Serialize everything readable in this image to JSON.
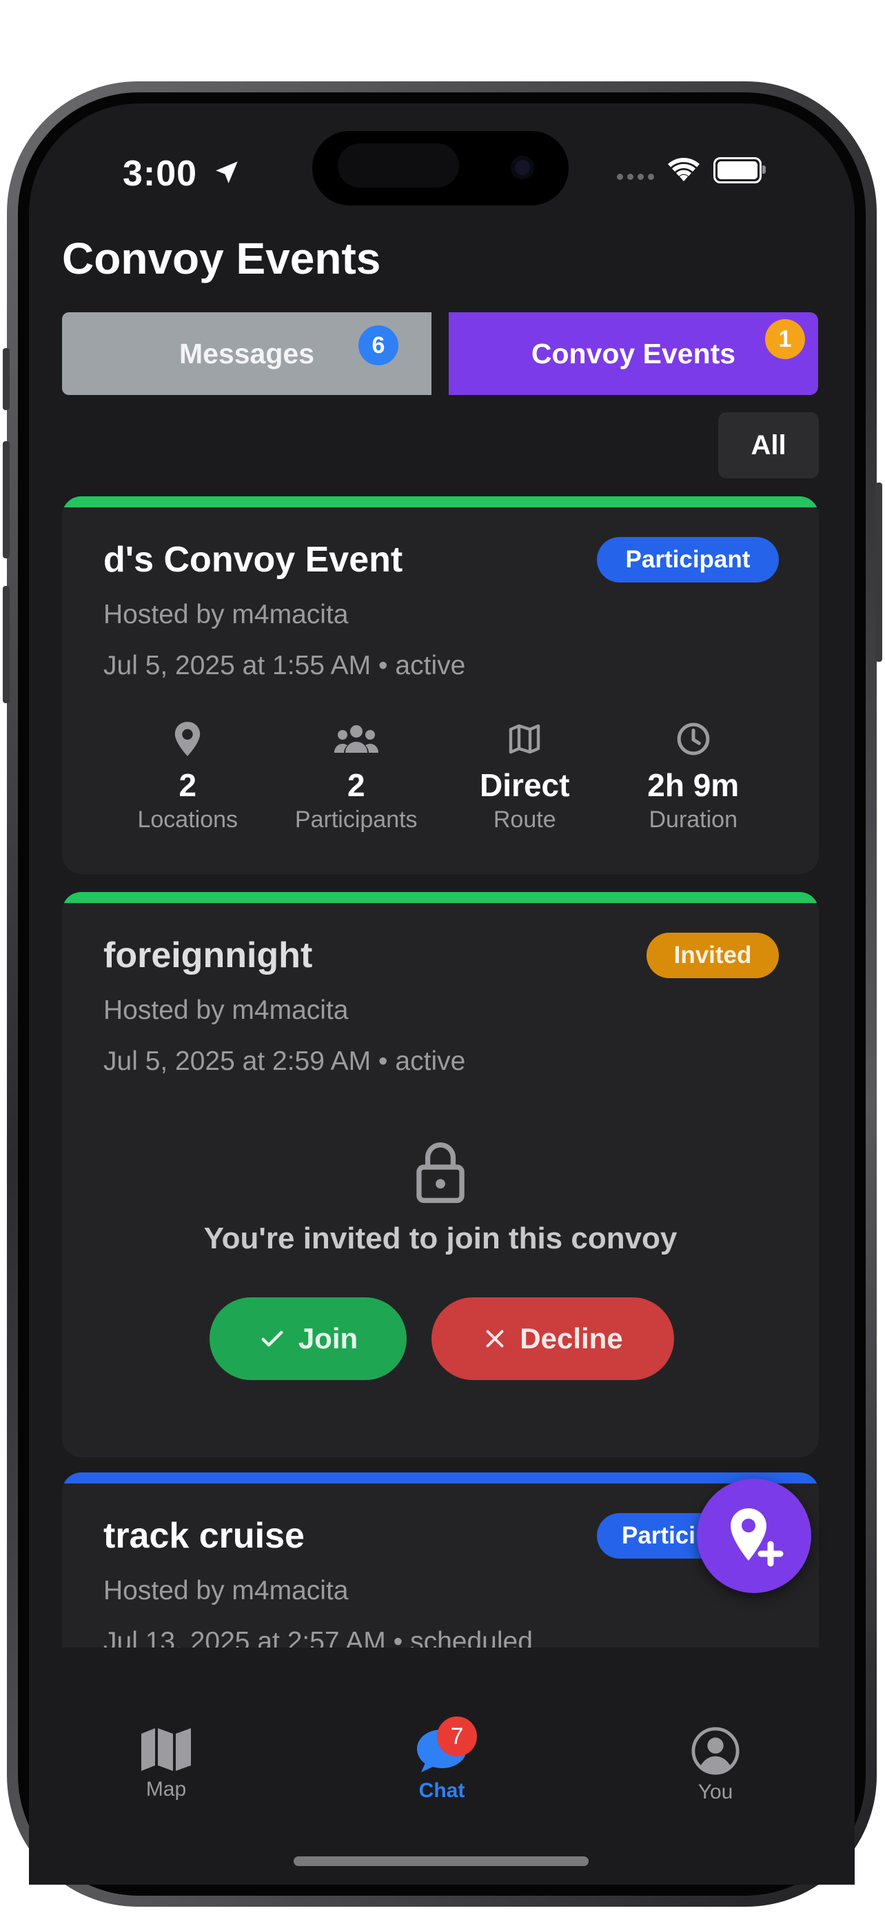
{
  "status_bar": {
    "time": "3:00"
  },
  "page": {
    "title": "Convoy Events"
  },
  "tabs": {
    "messages": {
      "label": "Messages",
      "badge": "6"
    },
    "events": {
      "label": "Convoy Events",
      "badge": "1"
    }
  },
  "filter": {
    "label": "All"
  },
  "events": [
    {
      "title": "d's Convoy Event",
      "role": "Participant",
      "host": "Hosted by m4macita",
      "date": "Jul 5, 2025 at 1:55 AM • active",
      "stats": [
        {
          "value": "2",
          "label": "Locations",
          "icon": "location-pin-icon"
        },
        {
          "value": "2",
          "label": "Participants",
          "icon": "users-icon"
        },
        {
          "value": "Direct",
          "label": "Route",
          "icon": "map-icon"
        },
        {
          "value": "2h 9m",
          "label": "Duration",
          "icon": "clock-icon"
        }
      ]
    },
    {
      "title": "foreignnight",
      "role": "Invited",
      "host": "Hosted by m4macita",
      "date": "Jul 5, 2025 at 2:59 AM • active",
      "invite_text": "You're invited to join this convoy",
      "join_label": "Join",
      "decline_label": "Decline"
    },
    {
      "title": "track cruise",
      "role": "Partici",
      "host": "Hosted by m4macita",
      "date": "Jul 13, 2025 at 2:57 AM • scheduled"
    }
  ],
  "nav": {
    "map": {
      "label": "Map"
    },
    "chat": {
      "label": "Chat",
      "badge": "7"
    },
    "you": {
      "label": "You"
    }
  },
  "colors": {
    "accent_purple": "#7b3be8",
    "active_green": "#22c55e",
    "scheduled_blue": "#2563eb",
    "invited_orange": "#d98c0a",
    "join_green": "#1fa652",
    "decline_red": "#cc3d3d",
    "chat_blue": "#2f80f5"
  }
}
